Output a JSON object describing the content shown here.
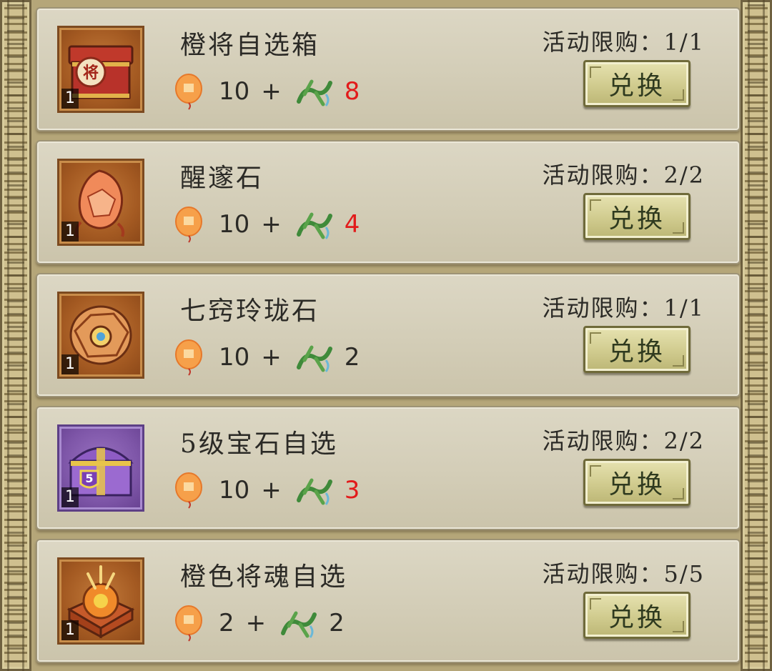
{
  "exchange_button_label": "兑换",
  "items": [
    {
      "name": "橙将自选箱",
      "limit": "活动限购：1/1",
      "quantity": "1",
      "lantern_cost": "10",
      "plus": "+",
      "jade_cost": "8",
      "jade_red": true,
      "icon": "general-chest-icon",
      "frame": "orange"
    },
    {
      "name": "醒邃石",
      "limit": "活动限购：2/2",
      "quantity": "1",
      "lantern_cost": "10",
      "plus": "+",
      "jade_cost": "4",
      "jade_red": true,
      "icon": "awakening-stone-icon",
      "frame": "orange"
    },
    {
      "name": "七窍玲珑石",
      "limit": "活动限购：1/1",
      "quantity": "1",
      "lantern_cost": "10",
      "plus": "+",
      "jade_cost": "2",
      "jade_red": false,
      "icon": "exquisite-stone-icon",
      "frame": "orange"
    },
    {
      "name": "5级宝石自选",
      "limit": "活动限购：2/2",
      "quantity": "1",
      "lantern_cost": "10",
      "plus": "+",
      "jade_cost": "3",
      "jade_red": true,
      "icon": "gem-chest-icon",
      "frame": "purple",
      "badge": "5"
    },
    {
      "name": "橙色将魂自选",
      "limit": "活动限购：5/5",
      "quantity": "1",
      "lantern_cost": "2",
      "plus": "+",
      "jade_cost": "2",
      "jade_red": false,
      "icon": "soul-box-icon",
      "frame": "orange"
    }
  ],
  "colors": {
    "insufficient": "#e21b1b",
    "normal": "#2b2a26"
  },
  "currency_icons": [
    "lantern-icon",
    "jade-ornament-icon"
  ]
}
